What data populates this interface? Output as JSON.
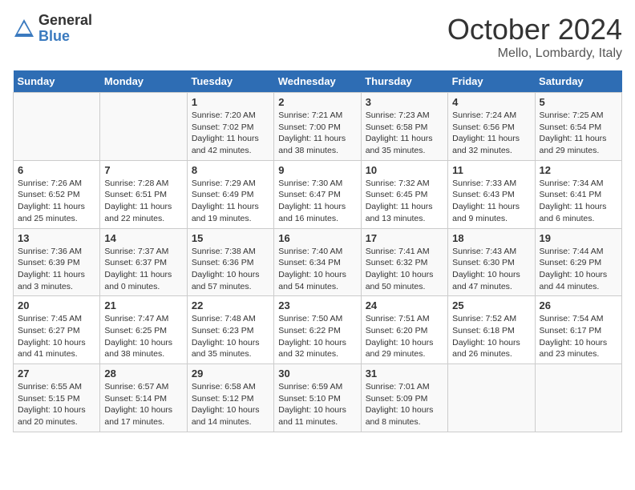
{
  "header": {
    "logo_general": "General",
    "logo_blue": "Blue",
    "month_title": "October 2024",
    "location": "Mello, Lombardy, Italy"
  },
  "days_of_week": [
    "Sunday",
    "Monday",
    "Tuesday",
    "Wednesday",
    "Thursday",
    "Friday",
    "Saturday"
  ],
  "weeks": [
    [
      {
        "day": "",
        "info": ""
      },
      {
        "day": "",
        "info": ""
      },
      {
        "day": "1",
        "info": "Sunrise: 7:20 AM\nSunset: 7:02 PM\nDaylight: 11 hours and 42 minutes."
      },
      {
        "day": "2",
        "info": "Sunrise: 7:21 AM\nSunset: 7:00 PM\nDaylight: 11 hours and 38 minutes."
      },
      {
        "day": "3",
        "info": "Sunrise: 7:23 AM\nSunset: 6:58 PM\nDaylight: 11 hours and 35 minutes."
      },
      {
        "day": "4",
        "info": "Sunrise: 7:24 AM\nSunset: 6:56 PM\nDaylight: 11 hours and 32 minutes."
      },
      {
        "day": "5",
        "info": "Sunrise: 7:25 AM\nSunset: 6:54 PM\nDaylight: 11 hours and 29 minutes."
      }
    ],
    [
      {
        "day": "6",
        "info": "Sunrise: 7:26 AM\nSunset: 6:52 PM\nDaylight: 11 hours and 25 minutes."
      },
      {
        "day": "7",
        "info": "Sunrise: 7:28 AM\nSunset: 6:51 PM\nDaylight: 11 hours and 22 minutes."
      },
      {
        "day": "8",
        "info": "Sunrise: 7:29 AM\nSunset: 6:49 PM\nDaylight: 11 hours and 19 minutes."
      },
      {
        "day": "9",
        "info": "Sunrise: 7:30 AM\nSunset: 6:47 PM\nDaylight: 11 hours and 16 minutes."
      },
      {
        "day": "10",
        "info": "Sunrise: 7:32 AM\nSunset: 6:45 PM\nDaylight: 11 hours and 13 minutes."
      },
      {
        "day": "11",
        "info": "Sunrise: 7:33 AM\nSunset: 6:43 PM\nDaylight: 11 hours and 9 minutes."
      },
      {
        "day": "12",
        "info": "Sunrise: 7:34 AM\nSunset: 6:41 PM\nDaylight: 11 hours and 6 minutes."
      }
    ],
    [
      {
        "day": "13",
        "info": "Sunrise: 7:36 AM\nSunset: 6:39 PM\nDaylight: 11 hours and 3 minutes."
      },
      {
        "day": "14",
        "info": "Sunrise: 7:37 AM\nSunset: 6:37 PM\nDaylight: 11 hours and 0 minutes."
      },
      {
        "day": "15",
        "info": "Sunrise: 7:38 AM\nSunset: 6:36 PM\nDaylight: 10 hours and 57 minutes."
      },
      {
        "day": "16",
        "info": "Sunrise: 7:40 AM\nSunset: 6:34 PM\nDaylight: 10 hours and 54 minutes."
      },
      {
        "day": "17",
        "info": "Sunrise: 7:41 AM\nSunset: 6:32 PM\nDaylight: 10 hours and 50 minutes."
      },
      {
        "day": "18",
        "info": "Sunrise: 7:43 AM\nSunset: 6:30 PM\nDaylight: 10 hours and 47 minutes."
      },
      {
        "day": "19",
        "info": "Sunrise: 7:44 AM\nSunset: 6:29 PM\nDaylight: 10 hours and 44 minutes."
      }
    ],
    [
      {
        "day": "20",
        "info": "Sunrise: 7:45 AM\nSunset: 6:27 PM\nDaylight: 10 hours and 41 minutes."
      },
      {
        "day": "21",
        "info": "Sunrise: 7:47 AM\nSunset: 6:25 PM\nDaylight: 10 hours and 38 minutes."
      },
      {
        "day": "22",
        "info": "Sunrise: 7:48 AM\nSunset: 6:23 PM\nDaylight: 10 hours and 35 minutes."
      },
      {
        "day": "23",
        "info": "Sunrise: 7:50 AM\nSunset: 6:22 PM\nDaylight: 10 hours and 32 minutes."
      },
      {
        "day": "24",
        "info": "Sunrise: 7:51 AM\nSunset: 6:20 PM\nDaylight: 10 hours and 29 minutes."
      },
      {
        "day": "25",
        "info": "Sunrise: 7:52 AM\nSunset: 6:18 PM\nDaylight: 10 hours and 26 minutes."
      },
      {
        "day": "26",
        "info": "Sunrise: 7:54 AM\nSunset: 6:17 PM\nDaylight: 10 hours and 23 minutes."
      }
    ],
    [
      {
        "day": "27",
        "info": "Sunrise: 6:55 AM\nSunset: 5:15 PM\nDaylight: 10 hours and 20 minutes."
      },
      {
        "day": "28",
        "info": "Sunrise: 6:57 AM\nSunset: 5:14 PM\nDaylight: 10 hours and 17 minutes."
      },
      {
        "day": "29",
        "info": "Sunrise: 6:58 AM\nSunset: 5:12 PM\nDaylight: 10 hours and 14 minutes."
      },
      {
        "day": "30",
        "info": "Sunrise: 6:59 AM\nSunset: 5:10 PM\nDaylight: 10 hours and 11 minutes."
      },
      {
        "day": "31",
        "info": "Sunrise: 7:01 AM\nSunset: 5:09 PM\nDaylight: 10 hours and 8 minutes."
      },
      {
        "day": "",
        "info": ""
      },
      {
        "day": "",
        "info": ""
      }
    ]
  ]
}
